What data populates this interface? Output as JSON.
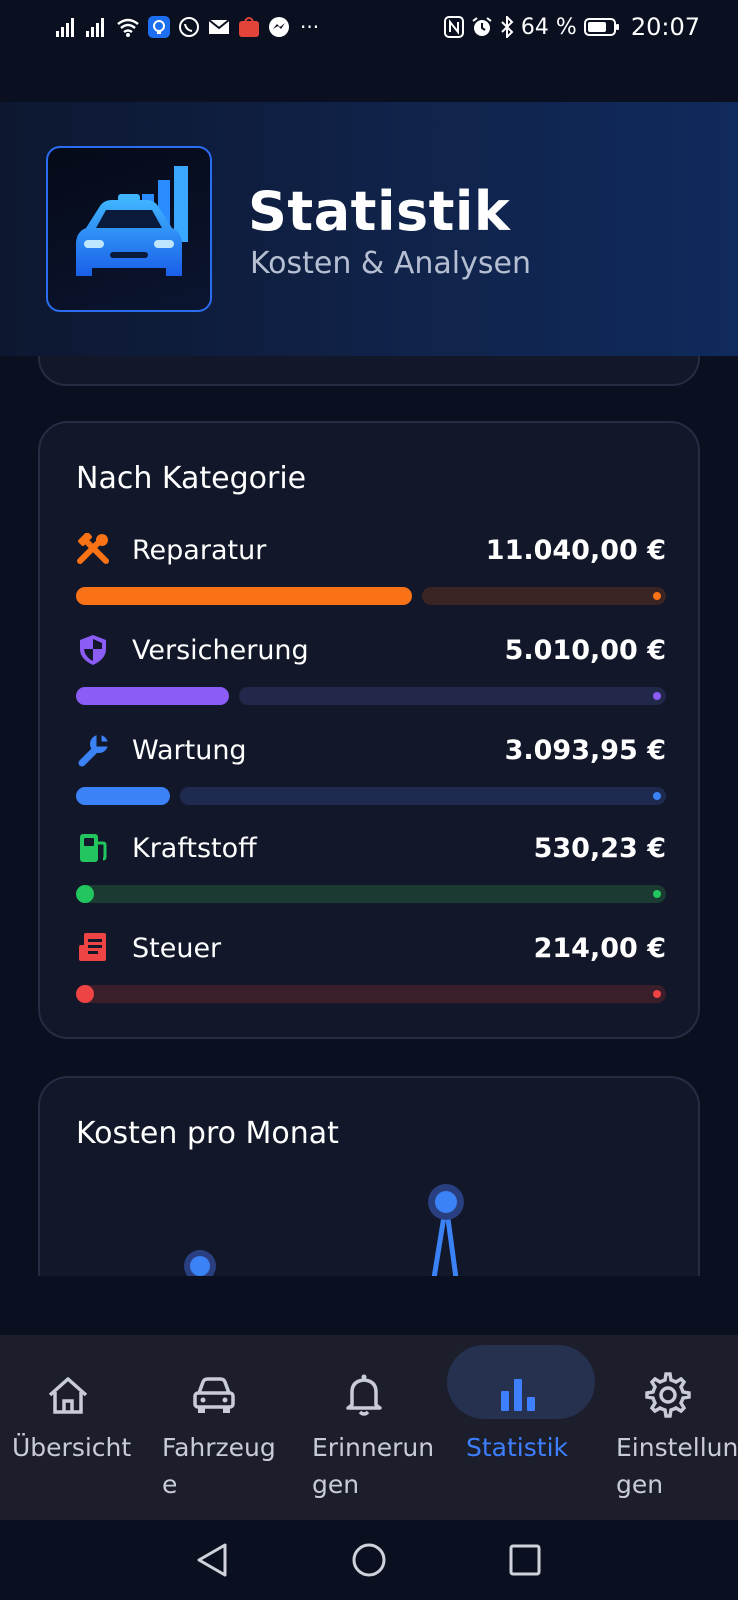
{
  "status_bar": {
    "battery": "64 %",
    "time": "20:07",
    "more": "···"
  },
  "header": {
    "title": "Statistik",
    "subtitle": "Kosten & Analysen"
  },
  "category_card": {
    "title": "Nach Kategorie",
    "items": [
      {
        "label": "Reparatur",
        "amount": "11.040,00 €",
        "value": 11040.0,
        "icon": "tools-icon",
        "color": "#f97316",
        "track": "#3a2424"
      },
      {
        "label": "Versicherung",
        "amount": "5.010,00 €",
        "value": 5010.0,
        "icon": "shield-icon",
        "color": "#8b5cf6",
        "track": "#22284a"
      },
      {
        "label": "Wartung",
        "amount": "3.093,95 €",
        "value": 3093.95,
        "icon": "wrench-icon",
        "color": "#3b82f6",
        "track": "#1e2a50"
      },
      {
        "label": "Kraftstoff",
        "amount": "530,23 €",
        "value": 530.23,
        "icon": "fuel-pump-icon",
        "color": "#22c55e",
        "track": "#1a3a32"
      },
      {
        "label": "Steuer",
        "amount": "214,00 €",
        "value": 214.0,
        "icon": "receipt-icon",
        "color": "#ef4444",
        "track": "#3a1e2a"
      }
    ]
  },
  "monthly_card": {
    "title": "Kosten pro Monat"
  },
  "tabbar": {
    "tabs": [
      {
        "label": "Übersicht",
        "icon": "home-icon"
      },
      {
        "label": "Fahrzeuge",
        "icon": "car-icon"
      },
      {
        "label": "Erinnerungen",
        "icon": "bell-icon"
      },
      {
        "label": "Statistik",
        "icon": "bar-chart-icon",
        "active": true
      },
      {
        "label": "Einstellungen",
        "icon": "gear-icon"
      }
    ]
  },
  "colors": {
    "accent": "#3d7fff",
    "background": "#0b1020",
    "card": "#121729"
  }
}
